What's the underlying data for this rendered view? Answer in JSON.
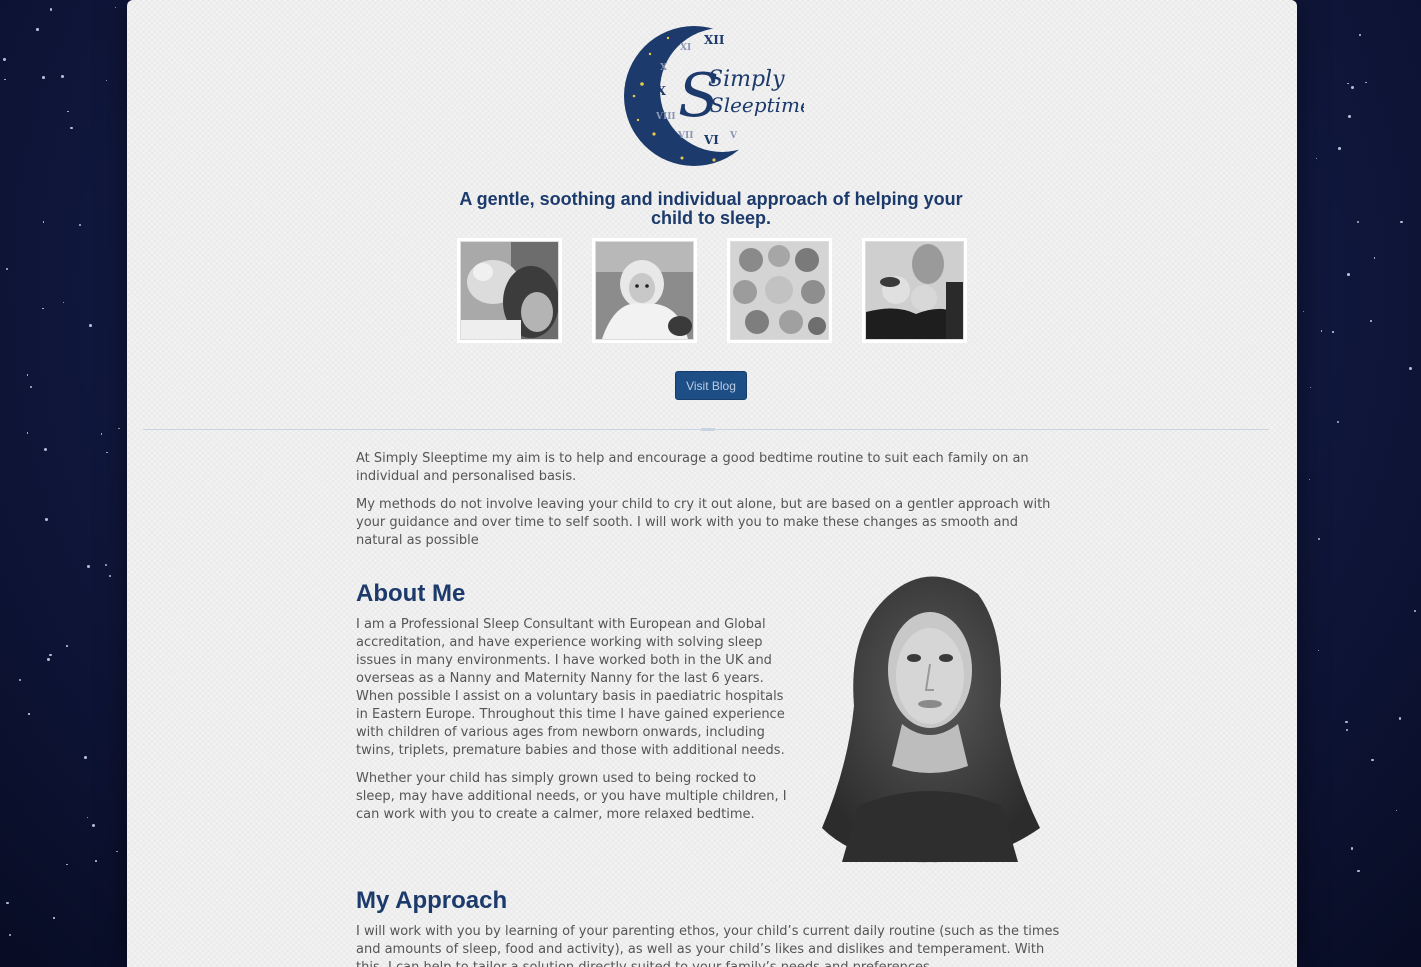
{
  "logo": {
    "wordmark_line1": "Simply",
    "wordmark_line2": "Sleeptime",
    "clock_numerals": [
      "XII",
      "XI",
      "X",
      "IX",
      "VIII",
      "VII",
      "VI",
      "V"
    ]
  },
  "tagline": "A gentle, soothing and individual approach of helping your child to sleep.",
  "photos": [
    {
      "name": "photo-mother-and-baby"
    },
    {
      "name": "photo-swaddled-baby"
    },
    {
      "name": "photo-group-of-babies"
    },
    {
      "name": "photo-woman-holding-twins"
    }
  ],
  "blog_button": "Visit Blog",
  "intro": [
    "At Simply Sleeptime my aim is to help and encourage a good bedtime routine to suit each family on an individual and personalised basis.",
    "My methods do not involve leaving your child to cry it out alone, but are based on a gentler approach with your guidance and over time to self sooth. I will work with you to make these changes as smooth and natural as possible"
  ],
  "about": {
    "title": "About Me",
    "paragraphs": [
      "I am a Professional Sleep Consultant with European and Global accreditation, and have experience working with solving sleep issues in many environments. I have worked both in the UK and overseas as a Nanny and Maternity Nanny for the last 6 years. When possible I assist on a voluntary basis in paediatric hospitals in Eastern Europe. Throughout this time I have gained experience with children of various ages from newborn onwards, including twins, triplets, premature babies and those with additional needs.",
      "Whether your child has simply grown used to being rocked to sleep, may have additional needs, or you have multiple children, I can work with you to create a calmer, more relaxed bedtime."
    ]
  },
  "approach": {
    "title": "My Approach",
    "paragraph": "I will work with you by learning of your parenting ethos, your child’s current daily routine (such as the times and amounts of sleep, food and activity), as well as your child’s likes and dislikes and temperament. With this, I can help to tailor a solution directly suited to your family’s needs and preferences."
  },
  "colors": {
    "brand_navy": "#1c3a6b",
    "button_blue": "#1d4f86",
    "body_text": "#555555",
    "page_bg": "#f3f3f3"
  }
}
